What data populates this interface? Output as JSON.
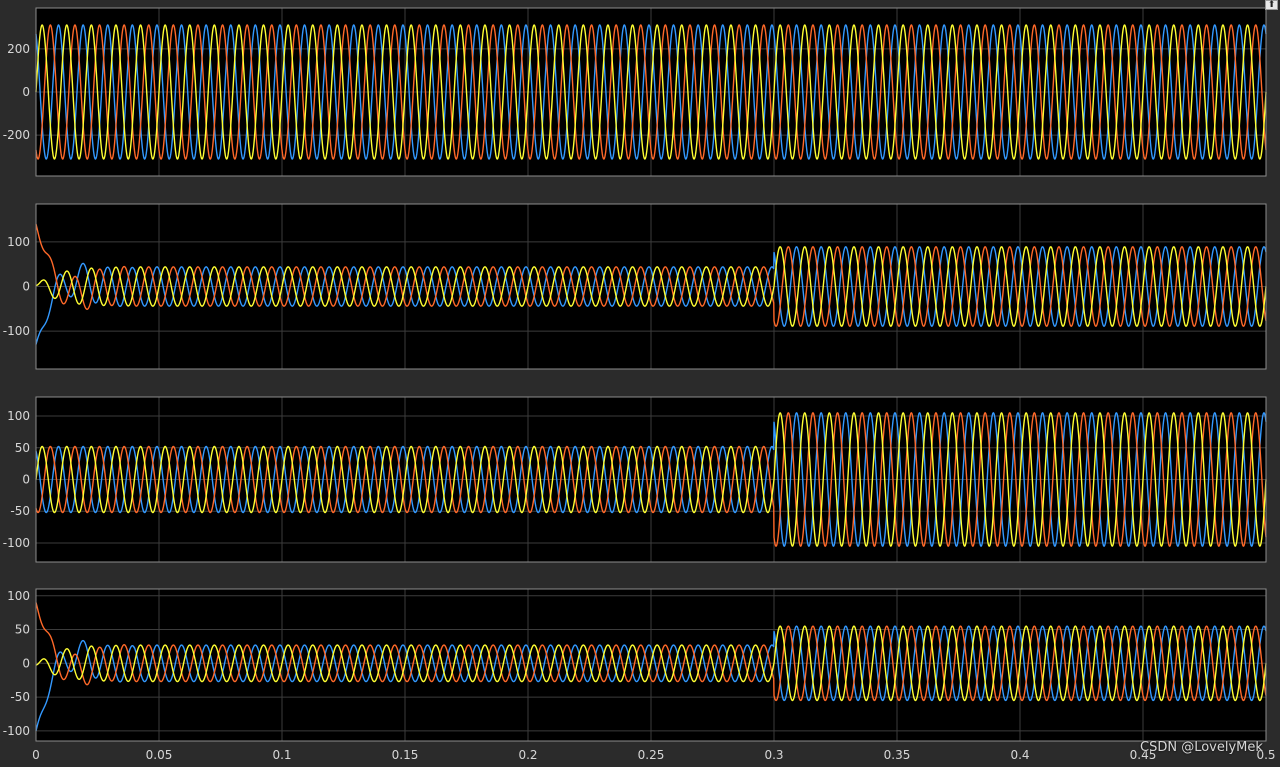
{
  "watermark": "CSDN @LovelyMek",
  "undock_icon": "undock-icon",
  "colors": {
    "background": "#2b2b2b",
    "axes_bg": "#000000",
    "grid": "#3c3c3c",
    "axis_frame": "#8c8c8c",
    "tick_text": "#d7d7d7",
    "phase_a": "#ffff33",
    "phase_b": "#ff6929",
    "phase_c": "#3399ff"
  },
  "chart_data": [
    {
      "type": "line",
      "panel": 1,
      "xlim": [
        0,
        0.5
      ],
      "ylim": [
        -390,
        390
      ],
      "yticks": [
        -200,
        0,
        200
      ],
      "grid": true,
      "frequency_hz": 100,
      "series": [
        {
          "phase": "a",
          "color": "#ffff33",
          "phase_shift_deg": 0
        },
        {
          "phase": "b",
          "color": "#ff6929",
          "phase_shift_deg": -120
        },
        {
          "phase": "c",
          "color": "#3399ff",
          "phase_shift_deg": 120
        }
      ],
      "segments": [
        {
          "t_start": 0,
          "t_end": 0.5,
          "amplitude": 311
        }
      ]
    },
    {
      "type": "line",
      "panel": 2,
      "xlim": [
        0,
        0.5
      ],
      "ylim": [
        -185,
        185
      ],
      "yticks": [
        -100,
        0,
        100
      ],
      "grid": true,
      "frequency_hz": 100,
      "series": [
        {
          "phase": "a",
          "color": "#ffff33",
          "phase_shift_deg": 0
        },
        {
          "phase": "b",
          "color": "#ff6929",
          "phase_shift_deg": -120
        },
        {
          "phase": "c",
          "color": "#3399ff",
          "phase_shift_deg": 120
        }
      ],
      "segments": [
        {
          "t_start": 0,
          "t_end": 0.3,
          "amplitude": 44
        },
        {
          "t_start": 0.3,
          "t_end": 0.5,
          "amplitude": 89
        }
      ],
      "startup_peak": {
        "max": 140,
        "min": -130
      }
    },
    {
      "type": "line",
      "panel": 3,
      "xlim": [
        0,
        0.5
      ],
      "ylim": [
        -130,
        130
      ],
      "yticks": [
        -100,
        -50,
        0,
        50,
        100
      ],
      "grid": true,
      "frequency_hz": 100,
      "series": [
        {
          "phase": "a",
          "color": "#ffff33",
          "phase_shift_deg": 0
        },
        {
          "phase": "b",
          "color": "#ff6929",
          "phase_shift_deg": -120
        },
        {
          "phase": "c",
          "color": "#3399ff",
          "phase_shift_deg": 120
        }
      ],
      "segments": [
        {
          "t_start": 0,
          "t_end": 0.3,
          "amplitude": 52
        },
        {
          "t_start": 0.3,
          "t_end": 0.5,
          "amplitude": 105
        }
      ]
    },
    {
      "type": "line",
      "panel": 4,
      "xlim": [
        0,
        0.5
      ],
      "ylim": [
        -115,
        110
      ],
      "yticks": [
        -100,
        -50,
        0,
        50,
        100
      ],
      "xticks": [
        0,
        0.05,
        0.1,
        0.15,
        0.2,
        0.25,
        0.3,
        0.35,
        0.4,
        0.45,
        0.5
      ],
      "xticklabels": [
        "0",
        "0.05",
        "0.1",
        "0.15",
        "0.2",
        "0.25",
        "0.3",
        "0.35",
        "0.4",
        "0.45",
        "0.5"
      ],
      "grid": true,
      "frequency_hz": 100,
      "series": [
        {
          "phase": "a",
          "color": "#ffff33",
          "phase_shift_deg": 0
        },
        {
          "phase": "b",
          "color": "#ff6929",
          "phase_shift_deg": -120
        },
        {
          "phase": "c",
          "color": "#3399ff",
          "phase_shift_deg": 120
        }
      ],
      "segments": [
        {
          "t_start": 0,
          "t_end": 0.3,
          "amplitude": 27
        },
        {
          "t_start": 0.3,
          "t_end": 0.5,
          "amplitude": 55
        }
      ],
      "startup_peak": {
        "max": 90,
        "min": -100
      }
    }
  ]
}
